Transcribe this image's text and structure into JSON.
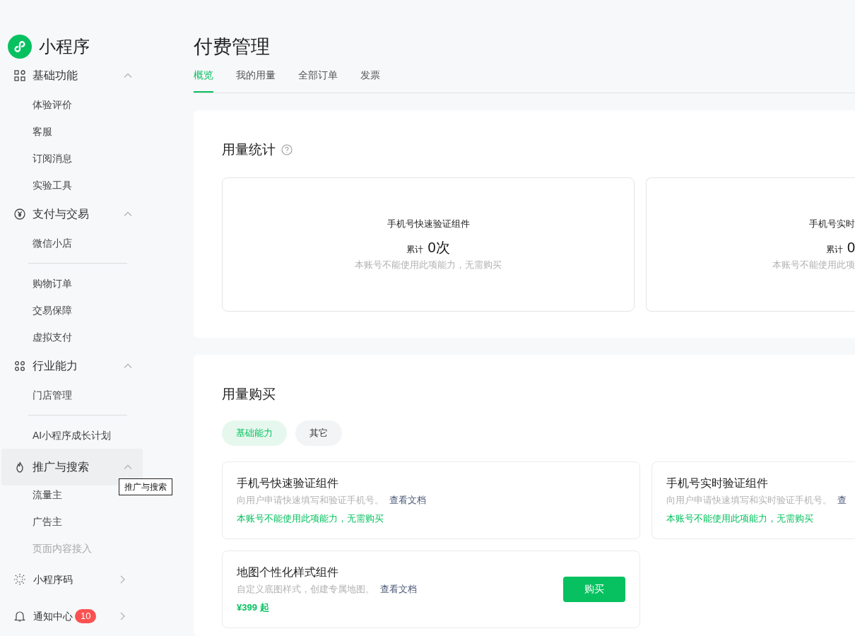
{
  "sidebar": {
    "app_name": "小程序",
    "groups": [
      {
        "label": "基础功能",
        "expanded": true,
        "hovered": false,
        "items": [
          {
            "label": "体验评价",
            "divider_after": false
          },
          {
            "label": "客服",
            "divider_after": false
          },
          {
            "label": "订阅消息",
            "divider_after": false
          },
          {
            "label": "实验工具",
            "divider_after": false
          }
        ]
      },
      {
        "label": "支付与交易",
        "expanded": true,
        "hovered": false,
        "items": [
          {
            "label": "微信小店",
            "divider_after": true
          },
          {
            "label": "购物订单",
            "divider_after": false
          },
          {
            "label": "交易保障",
            "divider_after": false
          },
          {
            "label": "虚拟支付",
            "divider_after": false
          }
        ]
      },
      {
        "label": "行业能力",
        "expanded": true,
        "hovered": false,
        "items": [
          {
            "label": "门店管理",
            "divider_after": true
          },
          {
            "label": "AI小程序成长计划",
            "divider_after": false
          }
        ]
      },
      {
        "label": "推广与搜索",
        "expanded": true,
        "hovered": true,
        "items": [
          {
            "label": "流量主",
            "divider_after": false
          },
          {
            "label": "广告主",
            "divider_after": false
          },
          {
            "label": "页面内容接入",
            "divider_after": false
          }
        ]
      }
    ],
    "tooltip": "推广与搜索",
    "footer_items": [
      {
        "label": "小程序码"
      },
      {
        "label": "通知中心",
        "badge": "10"
      }
    ]
  },
  "page": {
    "title": "付费管理",
    "tabs": [
      {
        "label": "概览",
        "selected": true
      },
      {
        "label": "我的用量",
        "selected": false
      },
      {
        "label": "全部订单",
        "selected": false
      },
      {
        "label": "发票",
        "selected": false
      }
    ]
  },
  "usage_stats": {
    "title": "用量统计",
    "cards": [
      {
        "title": "手机号快速验证组件",
        "prefix": "累计",
        "value": "0次",
        "note": "本账号不能使用此项能力，无需购买"
      },
      {
        "title": "手机号实时",
        "prefix": "累计",
        "value": "0",
        "note": "本账号不能使用此项"
      }
    ]
  },
  "usage_purchase": {
    "title": "用量购买",
    "filters": [
      {
        "label": "基础能力",
        "selected": true
      },
      {
        "label": "其它",
        "selected": false
      }
    ],
    "cards": [
      {
        "kind": "unavailable",
        "title": "手机号快速验证组件",
        "description": "向用户申请快速填写和验证手机号。",
        "link": "查看文档",
        "status": "本账号不能使用此项能力，无需购买"
      },
      {
        "kind": "unavailable",
        "title": "手机号实时验证组件",
        "description": "向用户申请快速填写和实时验证手机号。",
        "link": "查",
        "status": "本账号不能使用此项能力，无需购买"
      },
      {
        "kind": "purchasable",
        "title": "地图个性化样式组件",
        "description": "自定义底图样式，创建专属地图。",
        "link": "查看文档",
        "price": "¥399 起",
        "button": "购买"
      }
    ]
  }
}
